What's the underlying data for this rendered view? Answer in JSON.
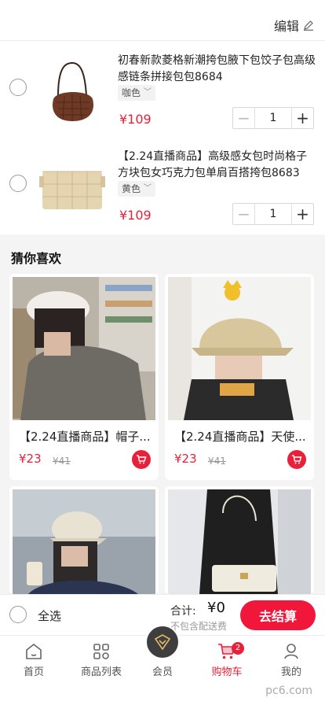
{
  "header": {
    "edit_label": "编辑"
  },
  "cart_items": [
    {
      "title": "初春新款菱格新潮挎包腋下包饺子包高级感链条拼接包包8684",
      "variant": "咖色",
      "price": "¥109",
      "quantity": "1"
    },
    {
      "title": "【2.24直播商品】高级感女包时尚格子方块包女巧克力包单肩百搭挎包8683",
      "variant": "黄色",
      "price": "¥109",
      "quantity": "1"
    }
  ],
  "recommend": {
    "title": "猜你喜欢",
    "items": [
      {
        "name": "【2.24直播商品】帽子...",
        "price": "¥23",
        "old_price": "¥41"
      },
      {
        "name": "【2.24直播商品】天使...",
        "price": "¥23",
        "old_price": "¥41"
      },
      {
        "name": "",
        "price": "",
        "old_price": ""
      },
      {
        "name": "",
        "price": "",
        "old_price": ""
      }
    ]
  },
  "checkout": {
    "select_all": "全选",
    "total_label": "合计:",
    "total_value": "¥0",
    "shipping_note": "不包含配送费",
    "pay_button": "去结算"
  },
  "tabbar": {
    "items": [
      {
        "label": "首页",
        "icon": "home-icon"
      },
      {
        "label": "商品列表",
        "icon": "grid-icon"
      },
      {
        "label": "会员",
        "icon": "member-icon"
      },
      {
        "label": "购物车",
        "icon": "cart-icon",
        "badge": "2"
      },
      {
        "label": "我的",
        "icon": "user-icon"
      }
    ]
  },
  "watermark": "pc6.com",
  "colors": {
    "accent": "#e8203a",
    "pay": "#f0173b"
  }
}
